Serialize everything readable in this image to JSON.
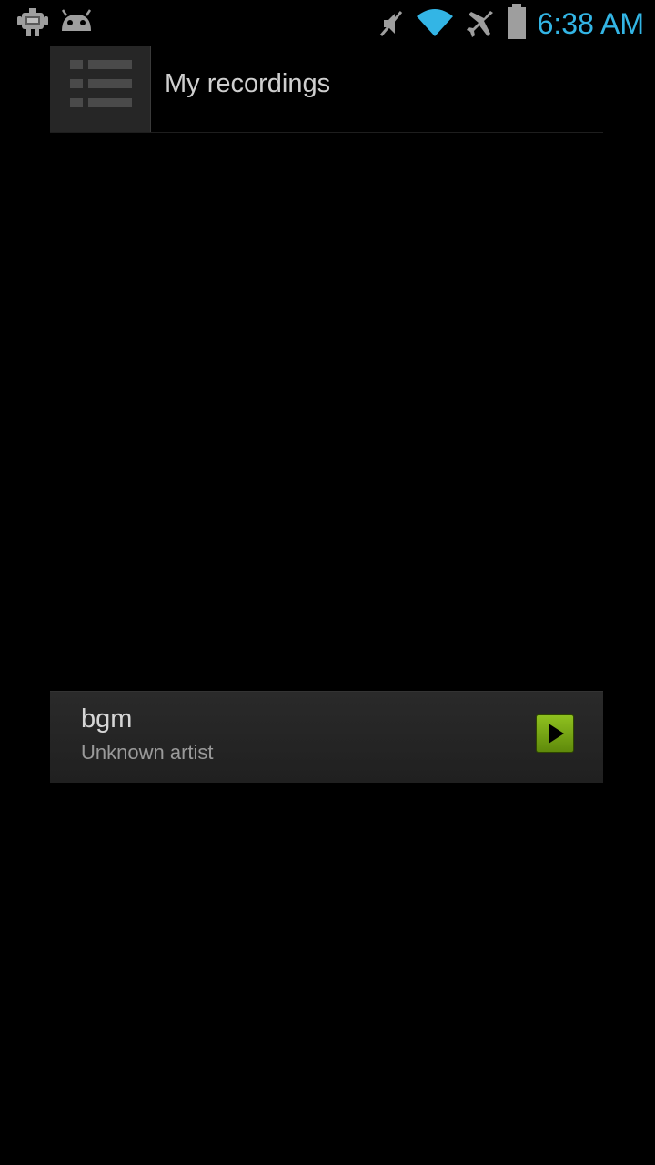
{
  "status_bar": {
    "time": "6:38 AM",
    "time_color": "#33b5e5",
    "icons": [
      "debug-robot-icon",
      "android-icon",
      "mute-icon",
      "wifi-icon",
      "airplane-mode-icon",
      "battery-icon"
    ]
  },
  "header": {
    "title": "My recordings",
    "menu_icon": "list-menu-icon"
  },
  "recordings": [
    {
      "title": "bgm",
      "artist": "Unknown artist",
      "action_icon": "play-icon",
      "action_color": "#7cb518"
    }
  ]
}
